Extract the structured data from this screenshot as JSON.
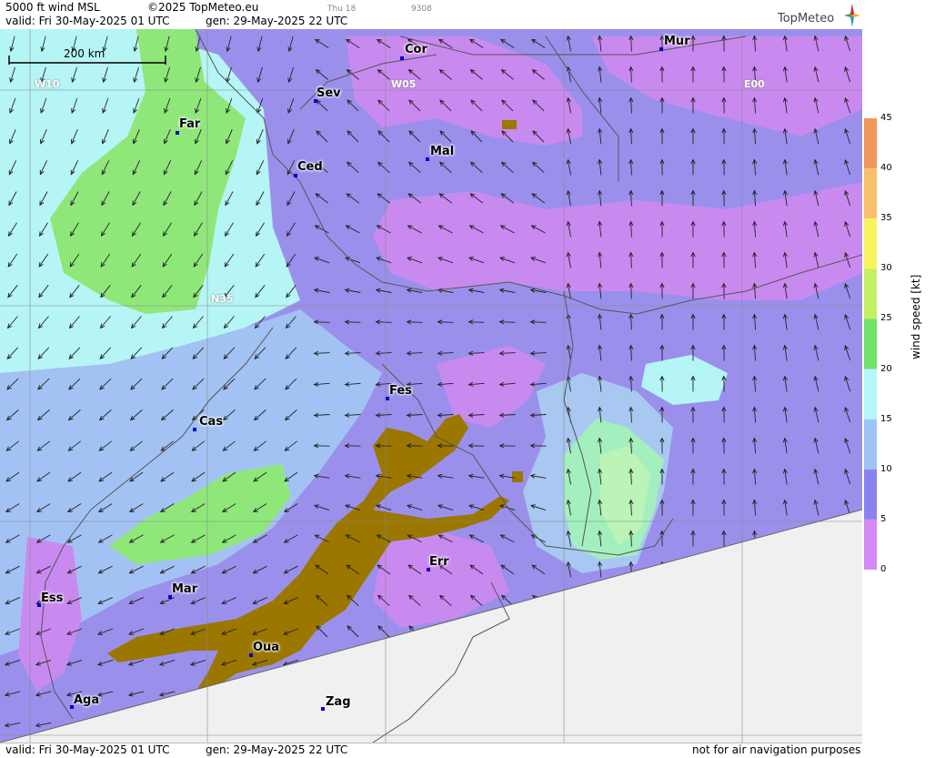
{
  "header": {
    "title": "5000 ft wind MSL",
    "copyright": "©2025 TopMeteo.eu",
    "valid": "valid:  Fri  30-May-2025  01 UTC",
    "generated": "gen: 29-May-2025 22 UTC",
    "small_1": "Thu 18",
    "small_2": "9308"
  },
  "logo": {
    "text": "TopMeteo"
  },
  "scale_bar": {
    "label": "200 km"
  },
  "grid_labels": {
    "w10": "W10",
    "w05": "W05",
    "e00": "E00",
    "n35": "N35"
  },
  "cities": [
    {
      "code": "Cor"
    },
    {
      "code": "Mur"
    },
    {
      "code": "Sev"
    },
    {
      "code": "Far"
    },
    {
      "code": "Ced"
    },
    {
      "code": "Mal"
    },
    {
      "code": "Fes"
    },
    {
      "code": "Cas"
    },
    {
      "code": "Err"
    },
    {
      "code": "Ess"
    },
    {
      "code": "Mar"
    },
    {
      "code": "Oua"
    },
    {
      "code": "Aga"
    },
    {
      "code": "Zag"
    }
  ],
  "legend": {
    "title": "wind speed [kt]",
    "ticks": [
      "45",
      "40",
      "35",
      "30",
      "25",
      "20",
      "15",
      "10",
      "5",
      "0"
    ],
    "colors": [
      "#e8705a",
      "#f2975a",
      "#f8c06a",
      "#f6f560",
      "#c4f064",
      "#6fe36a",
      "#b6f7f7",
      "#9ec4f5",
      "#8a82ef",
      "#d68af5"
    ]
  },
  "colors": {
    "purple": "#c98af0",
    "violet": "#9a90ec",
    "blue": "#a3c2f4",
    "cyan": "#b6f5f5",
    "green": "#8fe77a",
    "lime": "#c3f06a",
    "terrain": "#9b7700",
    "outside": "#f0f0f0"
  },
  "footer": {
    "valid": "valid:  Fri  30-May-2025  01 UTC",
    "generated": "gen: 29-May-2025 22 UTC",
    "disclaimer": "not for air navigation purposes"
  }
}
